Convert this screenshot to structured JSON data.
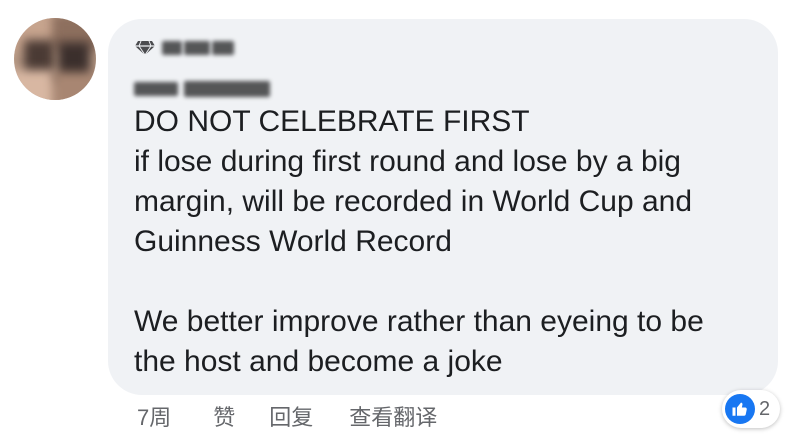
{
  "comment": {
    "lines": [
      "DO NOT CELEBRATE FIRST",
      "if lose during first round and lose by a big",
      "margin, will be recorded in World Cup and",
      "Guinness World Record"
    ],
    "lines2": [
      "We better improve rather than eyeing to be",
      "the host and become a joke"
    ]
  },
  "actions": {
    "time": "7周",
    "like": "赞",
    "reply": "回复",
    "translate": "查看翻译"
  },
  "reactions": {
    "count": "2",
    "type": "like-icon"
  },
  "colors": {
    "bubble": "#f0f2f5",
    "text": "#1c1e21",
    "meta": "#65676b",
    "like_blue": "#1877f2"
  }
}
